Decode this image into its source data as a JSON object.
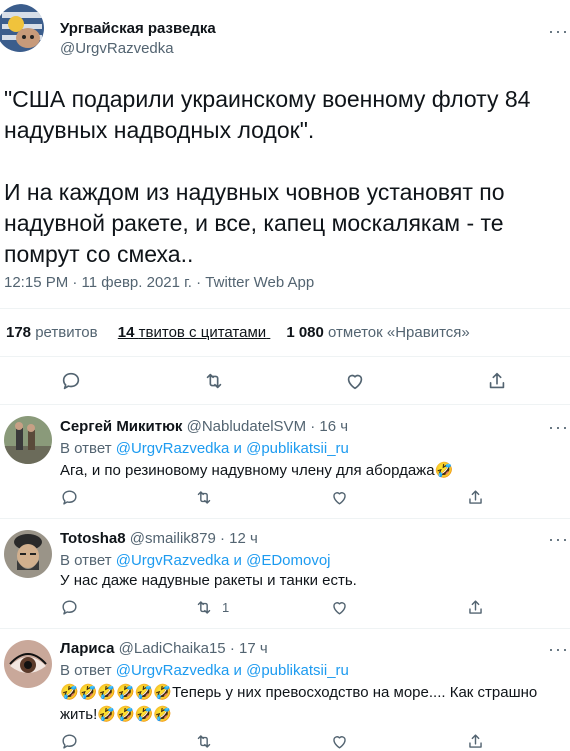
{
  "tweet": {
    "author_name": "Ургвайская разведка",
    "author_handle": "@UrgvRazvedka",
    "text_line1": "\"США подарили украинскому военному флоту 84",
    "text_line2": "надувных надводных лодок\".",
    "text_line3": "И на каждом из надувных човнов установят по",
    "text_line4": "надувной ракете, и все, капец москалякам - те",
    "text_line5": "помрут со смеха..",
    "meta": "12:15 PM · 11 февр. 2021 г. · Twitter Web App",
    "more_icon": "···"
  },
  "stats": {
    "retweets_count": "178",
    "retweets_label": "ретвитов",
    "quotes_count": "14",
    "quotes_label": "твитов с цитатами",
    "likes_count": "1 080",
    "likes_label": "отметок «Нравится»"
  },
  "replies": [
    {
      "name": "Сергей Микитюк",
      "handle": "@NabludatelSVM",
      "time": "· 16 ч",
      "reply_prefix": "В ответ",
      "reply_to_1": "@UrgvRazvedka",
      "reply_and": "и",
      "reply_to_2": "@publikatsii_ru",
      "text": "Ага, и по резиновому надувному члену для абордажа",
      "emoji_suffix": "🤣",
      "retweet_count": ""
    },
    {
      "name": "Totosha8",
      "handle": "@smailik879",
      "time": "· 12 ч",
      "reply_prefix": "В ответ",
      "reply_to_1": "@UrgvRazvedka",
      "reply_and": "и",
      "reply_to_2": "@EDomovoj",
      "text": "У нас даже надувные ракеты и танки есть.",
      "emoji_suffix": "",
      "retweet_count": "1"
    },
    {
      "name": "Лариса",
      "handle": "@LadiChaika15",
      "time": "· 17 ч",
      "reply_prefix": "В ответ",
      "reply_to_1": "@UrgvRazvedka",
      "reply_and": "и",
      "reply_to_2": "@publikatsii_ru",
      "emoji_prefix": "🤣🤣🤣🤣🤣🤣",
      "text_line1": "Теперь у них превосходство на море.... Как страшно",
      "text_line2": "жить!",
      "emoji_suffix": "🤣🤣🤣🤣",
      "retweet_count": ""
    }
  ],
  "colors": {
    "accent": "#1d9bf0",
    "muted": "#536471",
    "divider": "#eff3f4"
  },
  "icons": [
    "reply-icon",
    "retweet-icon",
    "like-icon",
    "share-icon",
    "more-icon"
  ]
}
